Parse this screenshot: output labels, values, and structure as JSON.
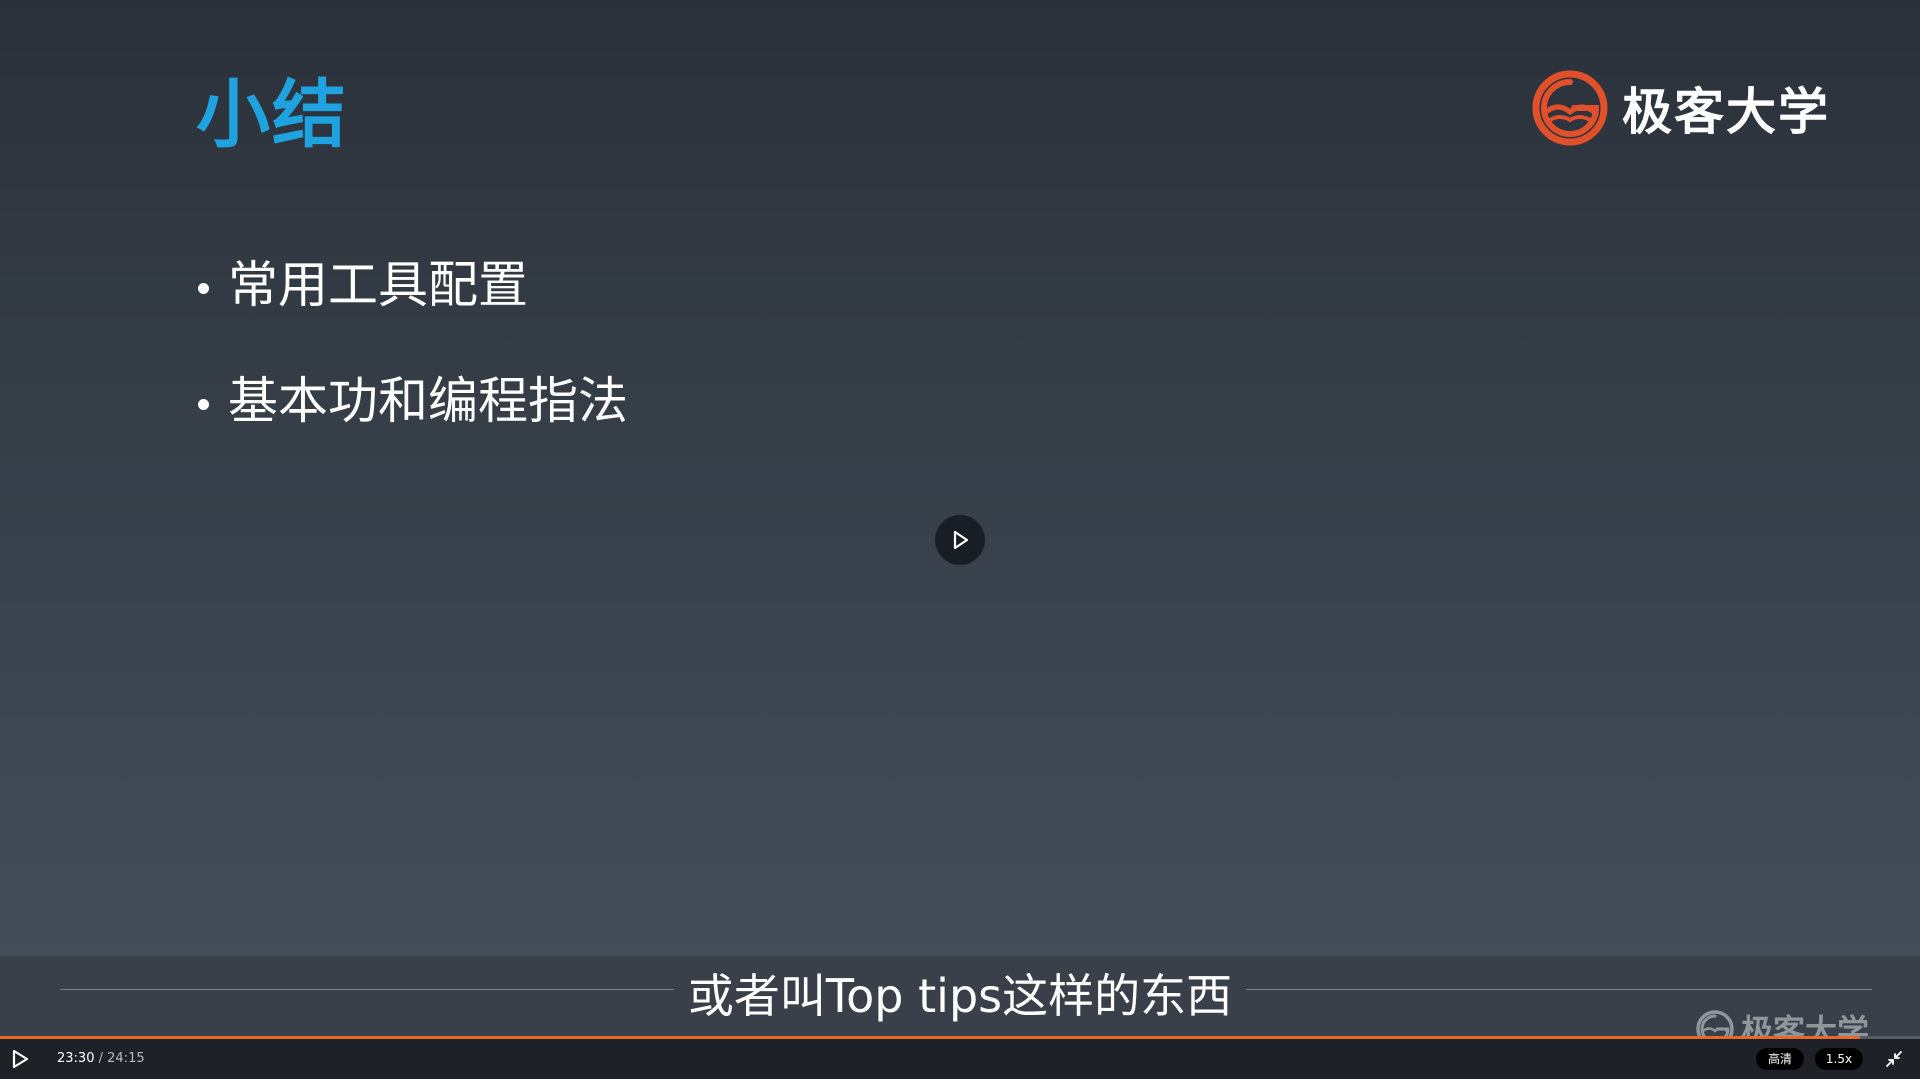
{
  "slide": {
    "title": "小结",
    "bullets": [
      "常用工具配置",
      "基本功和编程指法"
    ],
    "brand_logo": {
      "icon": "geektime-g-logo-icon",
      "text": "极客大学",
      "color": "#e0502a"
    },
    "title_color": "#1fa3e0"
  },
  "subtitle": "或者叫Top tips这样的东西",
  "watermark": {
    "icon": "geektime-g-logo-icon",
    "text": "极客大学"
  },
  "player": {
    "center_play_icon": "play-icon",
    "controls": {
      "play_icon": "play-icon",
      "current_time": "23:30",
      "separator": "/",
      "duration": "24:15",
      "progress": 0.969,
      "quality": "高清",
      "speed": "1.5x",
      "exit_fullscreen_icon": "exit-fullscreen-icon"
    },
    "accent_color": "#e8672b"
  }
}
